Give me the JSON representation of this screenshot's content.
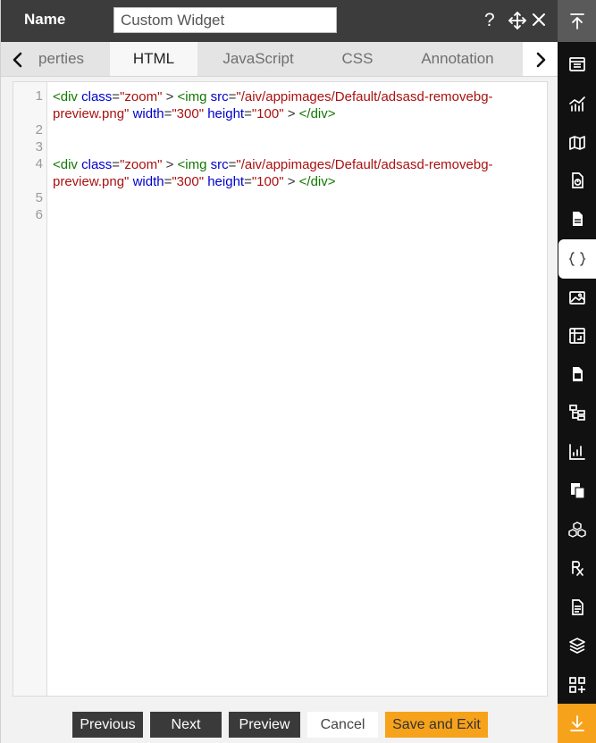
{
  "header": {
    "name_label": "Name",
    "name_value": "Custom Widget",
    "help_icon": "help-icon",
    "move_icon": "move-icon",
    "close_icon": "close-icon"
  },
  "tabs": [
    {
      "label": "Properties",
      "visible_text": "perties",
      "active": false
    },
    {
      "label": "HTML",
      "active": true
    },
    {
      "label": "JavaScript",
      "active": false
    },
    {
      "label": "CSS",
      "active": false
    },
    {
      "label": "Annotation",
      "active": false
    }
  ],
  "editor": {
    "line_numbers": [
      "1",
      "2",
      "3",
      "4",
      "5",
      "6"
    ],
    "lines": [
      {
        "number": "1",
        "tokens": [
          {
            "t": "tag",
            "v": "<div "
          },
          {
            "t": "attr",
            "v": "class"
          },
          {
            "t": "plain",
            "v": "="
          },
          {
            "t": "str",
            "v": "\"zoom\""
          },
          {
            "t": "plain",
            "v": " > "
          },
          {
            "t": "tag",
            "v": "<img "
          },
          {
            "t": "attr",
            "v": "src"
          },
          {
            "t": "plain",
            "v": "="
          },
          {
            "t": "str",
            "v": "\"/aiv/appimages/Default/adsasd-removebg-preview.png\""
          },
          {
            "t": "plain",
            "v": " "
          },
          {
            "t": "attr",
            "v": "width"
          },
          {
            "t": "plain",
            "v": "="
          },
          {
            "t": "str",
            "v": "\"300\""
          },
          {
            "t": "plain",
            "v": " "
          },
          {
            "t": "attr",
            "v": "height"
          },
          {
            "t": "plain",
            "v": "="
          },
          {
            "t": "str",
            "v": "\"100\""
          },
          {
            "t": "plain",
            "v": " >  "
          },
          {
            "t": "tag",
            "v": "</div>"
          }
        ]
      },
      {
        "number": "2",
        "tokens": []
      },
      {
        "number": "3",
        "tokens": []
      },
      {
        "number": "4",
        "tokens": [
          {
            "t": "tag",
            "v": "<div "
          },
          {
            "t": "attr",
            "v": "class"
          },
          {
            "t": "plain",
            "v": "="
          },
          {
            "t": "str",
            "v": "\"zoom\""
          },
          {
            "t": "plain",
            "v": " > "
          },
          {
            "t": "tag",
            "v": "<img "
          },
          {
            "t": "attr",
            "v": "src"
          },
          {
            "t": "plain",
            "v": "="
          },
          {
            "t": "str",
            "v": "\"/aiv/appimages/Default/adsasd-removebg-preview.png\""
          },
          {
            "t": "plain",
            "v": " "
          },
          {
            "t": "attr",
            "v": "width"
          },
          {
            "t": "plain",
            "v": "="
          },
          {
            "t": "str",
            "v": "\"300\""
          },
          {
            "t": "plain",
            "v": " "
          },
          {
            "t": "attr",
            "v": "height"
          },
          {
            "t": "plain",
            "v": "="
          },
          {
            "t": "str",
            "v": "\"100\""
          },
          {
            "t": "plain",
            "v": " >  "
          },
          {
            "t": "tag",
            "v": "</div>"
          }
        ]
      },
      {
        "number": "5",
        "tokens": []
      },
      {
        "number": "6",
        "tokens": []
      }
    ]
  },
  "buttons": {
    "previous": "Previous",
    "next": "Next",
    "preview": "Preview",
    "cancel": "Cancel",
    "save_exit": "Save and Exit"
  },
  "toolbar": {
    "items": [
      "scroll-to-top-icon",
      "table-icon",
      "chart-icon",
      "map-icon",
      "report-icon",
      "document-icon",
      "custom-widget-icon",
      "image-icon",
      "pivot-icon",
      "calculator-icon",
      "tree-icon",
      "kpi-chart-icon",
      "copy-page-icon",
      "cubes-icon",
      "rx-icon",
      "text-document-icon",
      "layers-icon",
      "add-widget-icon",
      "download-icon"
    ],
    "active_item": "custom-widget-icon"
  },
  "colors": {
    "header_bg": "#3c3c3c",
    "rail_bg": "#111111",
    "accent_orange": "#f7a21b",
    "tag": "#117700",
    "attribute": "#0000cc",
    "string": "#aa1111"
  }
}
